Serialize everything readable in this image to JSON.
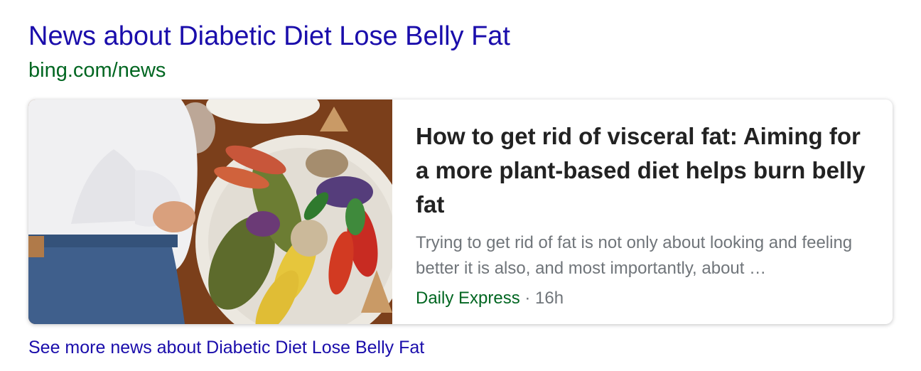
{
  "news_block": {
    "heading": "News about Diabetic Diet Lose Belly Fat",
    "source_url": "bing.com/news",
    "card": {
      "title": "How to get rid of visceral fat: Aiming for a more plant-based diet helps burn belly fat",
      "snippet": "Trying to get rid of fat is not only about looking and feeling better it is also, and most importantly, about …",
      "publisher": "Daily Express",
      "separator": " · ",
      "age": "16h"
    },
    "more_link": "See more news about Diabetic Diet Lose Belly Fat"
  },
  "colors": {
    "link": "#1a0dab",
    "url_green": "#006621",
    "title_text": "#222222",
    "snippet_gray": "#70757a"
  }
}
